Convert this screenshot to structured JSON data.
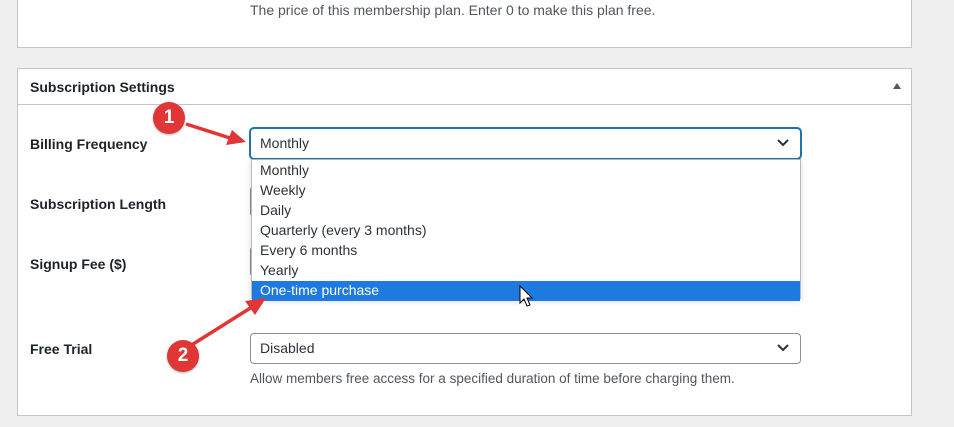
{
  "price_section": {
    "help_text": "The price of this membership plan. Enter 0 to make this plan free."
  },
  "subscription_settings": {
    "title": "Subscription Settings",
    "fields": {
      "billing_frequency": {
        "label": "Billing Frequency",
        "value": "Monthly"
      },
      "subscription_length": {
        "label": "Subscription Length"
      },
      "signup_fee": {
        "label": "Signup Fee ($)"
      },
      "free_trial": {
        "label": "Free Trial",
        "value": "Disabled",
        "help": "Allow members free access for a specified duration of time before charging them."
      }
    }
  },
  "dropdown": {
    "options": [
      "Monthly",
      "Weekly",
      "Daily",
      "Quarterly (every 3 months)",
      "Every 6 months",
      "Yearly",
      "One-time purchase"
    ],
    "highlighted": "One-time purchase"
  },
  "annotations": {
    "badge_1": "1",
    "badge_2": "2"
  },
  "colors": {
    "accent": "#2271b1",
    "highlight": "#1f7ae0",
    "badge": "#e03636"
  },
  "icons": [
    "collapse-toggle-icon",
    "chevron-down-icon",
    "arrow-pointer-icon",
    "mouse-cursor-icon"
  ]
}
